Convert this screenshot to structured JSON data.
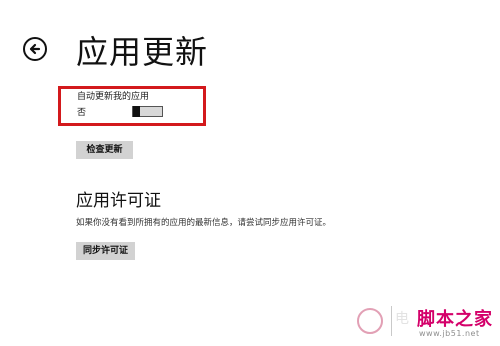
{
  "header": {
    "title": "应用更新",
    "back_icon": "back-arrow-icon"
  },
  "auto_update": {
    "label": "自动更新我的应用",
    "state_label": "否",
    "toggle_on": false
  },
  "check_updates_button": "检查更新",
  "license_section": {
    "heading": "应用许可证",
    "description": "如果你没有看到所拥有的应用的最新信息，请尝试同步应用许可证。",
    "sync_button": "同步许可证"
  },
  "watermark": {
    "text": "脚本之家",
    "faint_text": "电",
    "url": "www.jb51.net"
  },
  "colors": {
    "highlight": "#d3191c",
    "button_bg": "#d2d2d2",
    "watermark": "#d4006a"
  }
}
